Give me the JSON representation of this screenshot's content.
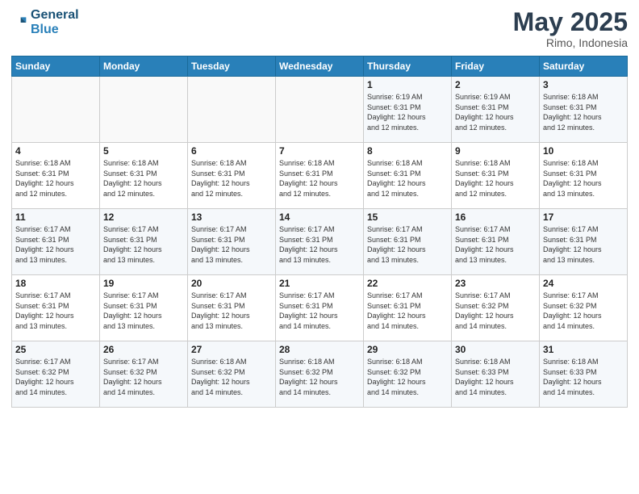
{
  "header": {
    "logo_line1": "General",
    "logo_line2": "Blue",
    "month": "May 2025",
    "location": "Rimo, Indonesia"
  },
  "weekdays": [
    "Sunday",
    "Monday",
    "Tuesday",
    "Wednesday",
    "Thursday",
    "Friday",
    "Saturday"
  ],
  "weeks": [
    [
      {
        "day": "",
        "info": ""
      },
      {
        "day": "",
        "info": ""
      },
      {
        "day": "",
        "info": ""
      },
      {
        "day": "",
        "info": ""
      },
      {
        "day": "1",
        "info": "Sunrise: 6:19 AM\nSunset: 6:31 PM\nDaylight: 12 hours\nand 12 minutes."
      },
      {
        "day": "2",
        "info": "Sunrise: 6:19 AM\nSunset: 6:31 PM\nDaylight: 12 hours\nand 12 minutes."
      },
      {
        "day": "3",
        "info": "Sunrise: 6:18 AM\nSunset: 6:31 PM\nDaylight: 12 hours\nand 12 minutes."
      }
    ],
    [
      {
        "day": "4",
        "info": "Sunrise: 6:18 AM\nSunset: 6:31 PM\nDaylight: 12 hours\nand 12 minutes."
      },
      {
        "day": "5",
        "info": "Sunrise: 6:18 AM\nSunset: 6:31 PM\nDaylight: 12 hours\nand 12 minutes."
      },
      {
        "day": "6",
        "info": "Sunrise: 6:18 AM\nSunset: 6:31 PM\nDaylight: 12 hours\nand 12 minutes."
      },
      {
        "day": "7",
        "info": "Sunrise: 6:18 AM\nSunset: 6:31 PM\nDaylight: 12 hours\nand 12 minutes."
      },
      {
        "day": "8",
        "info": "Sunrise: 6:18 AM\nSunset: 6:31 PM\nDaylight: 12 hours\nand 12 minutes."
      },
      {
        "day": "9",
        "info": "Sunrise: 6:18 AM\nSunset: 6:31 PM\nDaylight: 12 hours\nand 12 minutes."
      },
      {
        "day": "10",
        "info": "Sunrise: 6:18 AM\nSunset: 6:31 PM\nDaylight: 12 hours\nand 13 minutes."
      }
    ],
    [
      {
        "day": "11",
        "info": "Sunrise: 6:17 AM\nSunset: 6:31 PM\nDaylight: 12 hours\nand 13 minutes."
      },
      {
        "day": "12",
        "info": "Sunrise: 6:17 AM\nSunset: 6:31 PM\nDaylight: 12 hours\nand 13 minutes."
      },
      {
        "day": "13",
        "info": "Sunrise: 6:17 AM\nSunset: 6:31 PM\nDaylight: 12 hours\nand 13 minutes."
      },
      {
        "day": "14",
        "info": "Sunrise: 6:17 AM\nSunset: 6:31 PM\nDaylight: 12 hours\nand 13 minutes."
      },
      {
        "day": "15",
        "info": "Sunrise: 6:17 AM\nSunset: 6:31 PM\nDaylight: 12 hours\nand 13 minutes."
      },
      {
        "day": "16",
        "info": "Sunrise: 6:17 AM\nSunset: 6:31 PM\nDaylight: 12 hours\nand 13 minutes."
      },
      {
        "day": "17",
        "info": "Sunrise: 6:17 AM\nSunset: 6:31 PM\nDaylight: 12 hours\nand 13 minutes."
      }
    ],
    [
      {
        "day": "18",
        "info": "Sunrise: 6:17 AM\nSunset: 6:31 PM\nDaylight: 12 hours\nand 13 minutes."
      },
      {
        "day": "19",
        "info": "Sunrise: 6:17 AM\nSunset: 6:31 PM\nDaylight: 12 hours\nand 13 minutes."
      },
      {
        "day": "20",
        "info": "Sunrise: 6:17 AM\nSunset: 6:31 PM\nDaylight: 12 hours\nand 13 minutes."
      },
      {
        "day": "21",
        "info": "Sunrise: 6:17 AM\nSunset: 6:31 PM\nDaylight: 12 hours\nand 14 minutes."
      },
      {
        "day": "22",
        "info": "Sunrise: 6:17 AM\nSunset: 6:31 PM\nDaylight: 12 hours\nand 14 minutes."
      },
      {
        "day": "23",
        "info": "Sunrise: 6:17 AM\nSunset: 6:32 PM\nDaylight: 12 hours\nand 14 minutes."
      },
      {
        "day": "24",
        "info": "Sunrise: 6:17 AM\nSunset: 6:32 PM\nDaylight: 12 hours\nand 14 minutes."
      }
    ],
    [
      {
        "day": "25",
        "info": "Sunrise: 6:17 AM\nSunset: 6:32 PM\nDaylight: 12 hours\nand 14 minutes."
      },
      {
        "day": "26",
        "info": "Sunrise: 6:17 AM\nSunset: 6:32 PM\nDaylight: 12 hours\nand 14 minutes."
      },
      {
        "day": "27",
        "info": "Sunrise: 6:18 AM\nSunset: 6:32 PM\nDaylight: 12 hours\nand 14 minutes."
      },
      {
        "day": "28",
        "info": "Sunrise: 6:18 AM\nSunset: 6:32 PM\nDaylight: 12 hours\nand 14 minutes."
      },
      {
        "day": "29",
        "info": "Sunrise: 6:18 AM\nSunset: 6:32 PM\nDaylight: 12 hours\nand 14 minutes."
      },
      {
        "day": "30",
        "info": "Sunrise: 6:18 AM\nSunset: 6:33 PM\nDaylight: 12 hours\nand 14 minutes."
      },
      {
        "day": "31",
        "info": "Sunrise: 6:18 AM\nSunset: 6:33 PM\nDaylight: 12 hours\nand 14 minutes."
      }
    ]
  ]
}
